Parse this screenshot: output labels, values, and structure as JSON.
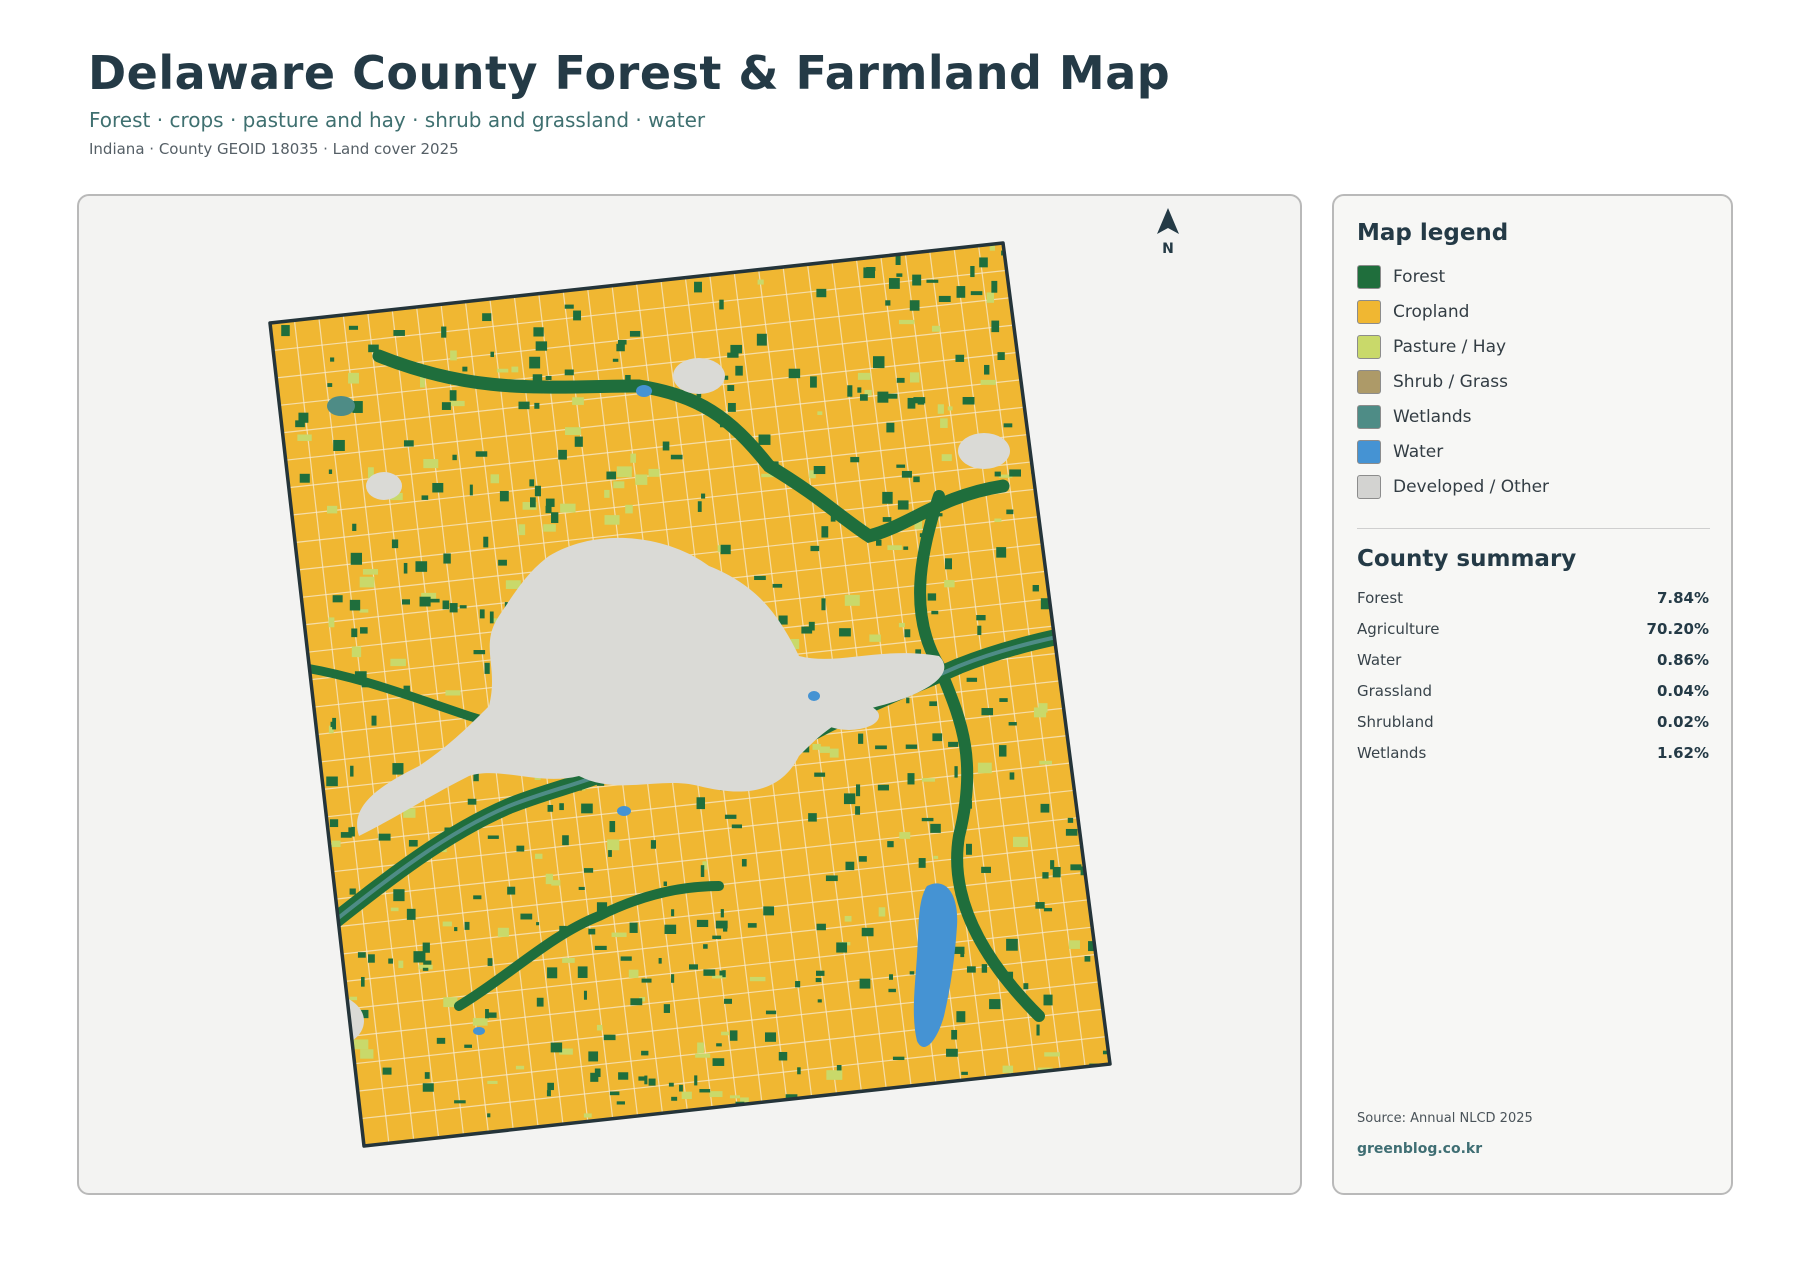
{
  "header": {
    "title": "Delaware County Forest & Farmland Map",
    "subtitle": "Forest · crops · pasture and hay · shrub and grassland · water",
    "meta": "Indiana · County GEOID 18035 · Land cover 2025"
  },
  "map": {
    "north_label": "N",
    "colors": {
      "forest": "#1f6e3c",
      "cropland": "#f0b732",
      "pasture": "#c9d96a",
      "shrub": "#ad9a68",
      "wetlands": "#4e8c86",
      "water": "#4593d3",
      "developed": "#dadad6",
      "border": "#24343a",
      "background": "#f3f3f2"
    }
  },
  "legend": {
    "title": "Map legend",
    "items": [
      {
        "label": "Forest",
        "color": "#1f6e3c"
      },
      {
        "label": "Cropland",
        "color": "#f0b732"
      },
      {
        "label": "Pasture / Hay",
        "color": "#c9d96a"
      },
      {
        "label": "Shrub / Grass",
        "color": "#ad9a68"
      },
      {
        "label": "Wetlands",
        "color": "#4e8c86"
      },
      {
        "label": "Water",
        "color": "#4593d3"
      },
      {
        "label": "Developed / Other",
        "color": "#d3d3d1"
      }
    ]
  },
  "summary": {
    "title": "County summary",
    "rows": [
      {
        "label": "Forest",
        "value": "7.84%"
      },
      {
        "label": "Agriculture",
        "value": "70.20%"
      },
      {
        "label": "Water",
        "value": "0.86%"
      },
      {
        "label": "Grassland",
        "value": "0.04%"
      },
      {
        "label": "Shrubland",
        "value": "0.02%"
      },
      {
        "label": "Wetlands",
        "value": "1.62%"
      }
    ]
  },
  "footer": {
    "source": "Source: Annual NLCD 2025",
    "credit": "greenblog.co.kr"
  }
}
